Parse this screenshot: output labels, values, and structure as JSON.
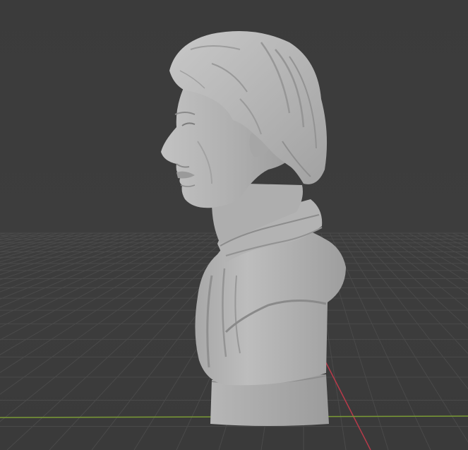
{
  "viewport": {
    "type": "3d-viewport",
    "background_color": "#3d3d3d",
    "grid_color": "#4a4a4a",
    "axis_x_color": "#b83a4a",
    "axis_y_color": "#7a9a35",
    "model_color": "#b5b5b5",
    "model_name": "bust-sculpture",
    "view": "side-profile"
  }
}
